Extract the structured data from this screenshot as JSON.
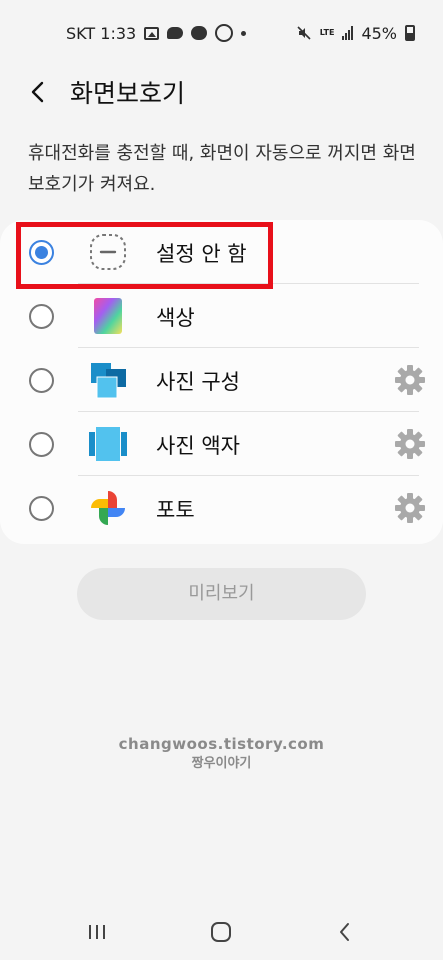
{
  "status_bar": {
    "carrier_time": "SKT 1:33",
    "lte": "LTE",
    "battery": "45%"
  },
  "header": {
    "title": "화면보호기"
  },
  "description": "휴대전화를 충전할 때, 화면이 자동으로 꺼지면 화면보호기가 켜져요.",
  "options": [
    {
      "label": "설정 안 함",
      "selected": true,
      "icon": "none-icon",
      "has_settings": false
    },
    {
      "label": "색상",
      "selected": false,
      "icon": "colors-icon",
      "has_settings": false
    },
    {
      "label": "사진 구성",
      "selected": false,
      "icon": "photo-table-icon",
      "has_settings": true
    },
    {
      "label": "사진 액자",
      "selected": false,
      "icon": "photo-frame-icon",
      "has_settings": true
    },
    {
      "label": "포토",
      "selected": false,
      "icon": "google-photos-icon",
      "has_settings": true
    }
  ],
  "preview_button": "미리보기",
  "watermark": {
    "line1": "changwoos.tistory.com",
    "line2": "짱우이야기"
  },
  "colors": {
    "accent": "#3b82e0",
    "highlight": "#e8101a",
    "background": "#f4f4f4",
    "card": "#fcfcfc"
  }
}
